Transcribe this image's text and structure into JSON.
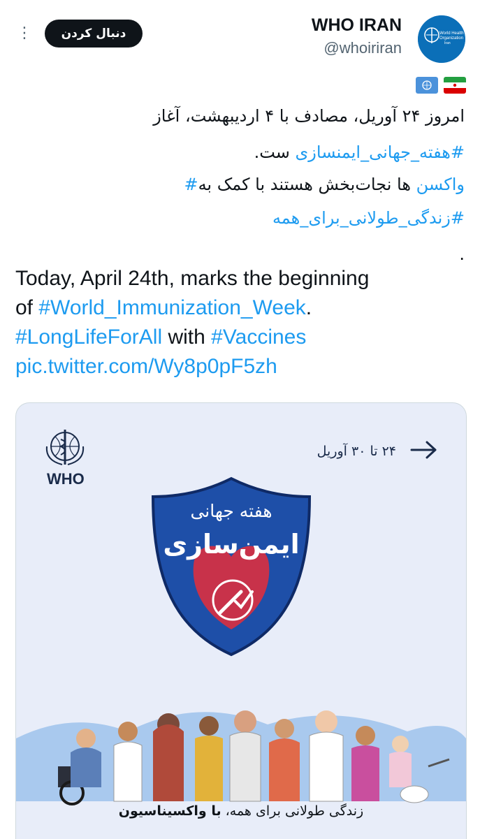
{
  "header": {
    "more_icon": "more-vertical-icon",
    "follow_label": "دنبال کردن",
    "display_name": "WHO IRAN",
    "handle": "@whoiriran",
    "avatar_text": [
      "World Health",
      "Organization",
      "Iran"
    ]
  },
  "flags": [
    "un-flag-icon",
    "iran-flag-icon"
  ],
  "tweet": {
    "fa_line1": "امروز ۲۴ آوریل، مصادف با ۴ اردیبهشت، آغاز",
    "fa_line2_hash": "#هفته_جهانی_ایمنسازی",
    "fa_line2_rest": " ست.",
    "fa_line3_hash": "واکسن",
    "fa_line3_rest": " ها نجات‌بخش هستند با کمک به",
    "fa_line3_end": "#",
    "fa_line4": "#زندگی_طولانی_برای_همه",
    "fa_dot": ".",
    "en_line1": "Today, April 24th, marks the beginning",
    "en_line2_pre": "of ",
    "en_line2_hash": "#World_Immunization_Week",
    "en_line2_post": ".",
    "en_line3_hash1": "#LongLifeForAll",
    "en_line3_mid": " with ",
    "en_line3_hash2": "#Vaccines",
    "en_line4_link": "pic.twitter.com/Wy8p0pF5zh"
  },
  "card": {
    "date_range": "۲۴ تا ۳۰ آوریل",
    "who_label": "WHO",
    "shield_line1": "هفته جهانی",
    "shield_line2": "ایمن‌سازی",
    "caption_normal": "زندگی طولانی برای همه، ",
    "caption_bold": "با واکسیناسیون",
    "colors": {
      "shield": "#1e4fa8",
      "heart": "#c8324a",
      "background": "#e8edf9"
    }
  }
}
